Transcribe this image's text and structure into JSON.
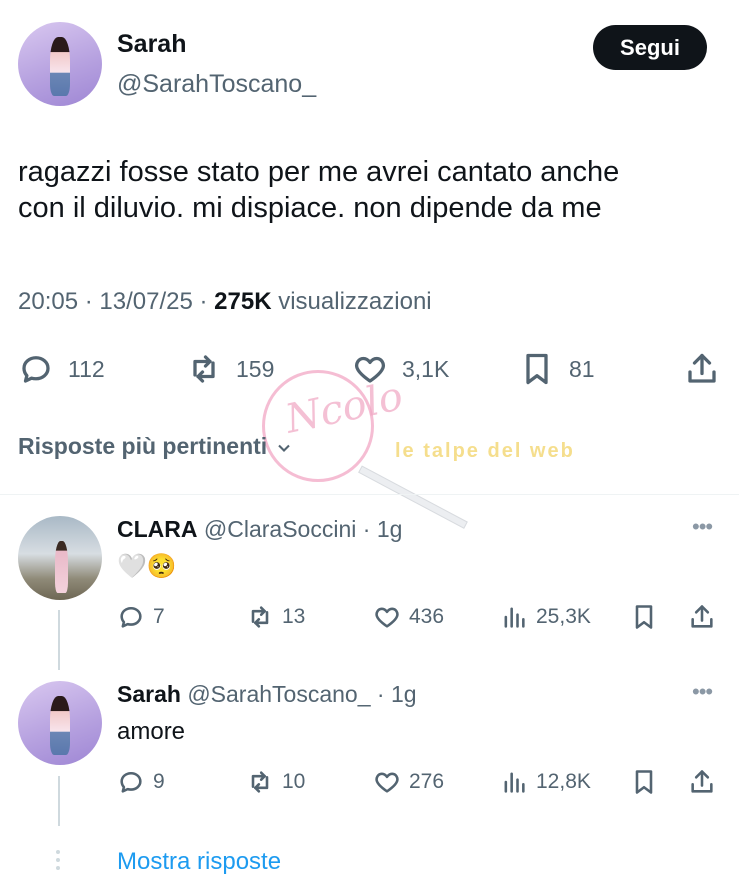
{
  "main_tweet": {
    "author_name": "Sarah",
    "author_handle": "@SarahToscano_",
    "follow_label": "Segui",
    "text_line1": "ragazzi fosse stato per me avrei cantato anche",
    "text_line2": "con il diluvio. mi dispiace. non dipende da me",
    "time": "20:05",
    "date": "13/07/25",
    "views_count": "275K",
    "views_label": "visualizzazioni",
    "replies": "112",
    "retweets": "159",
    "likes": "3,1K",
    "bookmarks": "81"
  },
  "replies_heading": "Risposte più pertinenti",
  "watermark": {
    "text1": "Ncolo",
    "text2": "le talpe del web"
  },
  "replies": [
    {
      "author_name": "CLARA",
      "author_handle": "@ClaraSoccini",
      "age": "1g",
      "text": "🤍🥺",
      "replies": "7",
      "retweets": "13",
      "likes": "436",
      "views": "25,3K"
    },
    {
      "author_name": "Sarah",
      "author_handle": "@SarahToscano_",
      "age": "1g",
      "text": "amore",
      "replies": "9",
      "retweets": "10",
      "likes": "276",
      "views": "12,8K"
    }
  ],
  "show_replies_label": "Mostra risposte",
  "icons": [
    "reply-icon",
    "retweet-icon",
    "like-icon",
    "bookmark-icon",
    "share-icon",
    "views-icon",
    "more-icon",
    "chevron-down-icon"
  ],
  "colors": {
    "link": "#1d9bf0",
    "muted": "#536471",
    "text": "#0f1419",
    "follow_bg": "#0f1419"
  }
}
